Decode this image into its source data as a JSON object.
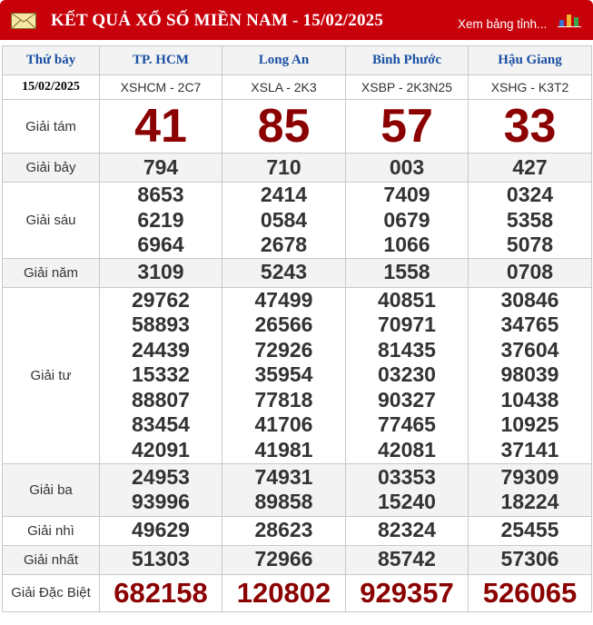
{
  "header": {
    "title": "KẾT QUẢ XỔ SỐ MIỀN NAM - 15/02/2025",
    "more_link": "Xem bảng tỉnh...",
    "bg_color": "#c8000a"
  },
  "table": {
    "day_label": "Thứ bảy",
    "date": "15/02/2025",
    "provinces": [
      {
        "name": "TP. HCM",
        "code": "XSHCM - 2C7"
      },
      {
        "name": "Long An",
        "code": "XSLA - 2K3"
      },
      {
        "name": "Bình Phước",
        "code": "XSBP - 2K3N25"
      },
      {
        "name": "Hậu Giang",
        "code": "XSHG - K3T2"
      }
    ],
    "prizes": {
      "g8": {
        "label": "Giải tám",
        "values": [
          "41",
          "85",
          "57",
          "33"
        ]
      },
      "g7": {
        "label": "Giải bảy",
        "values": [
          "794",
          "710",
          "003",
          "427"
        ]
      },
      "g6": {
        "label": "Giải sáu",
        "values": [
          [
            "8653",
            "6219",
            "6964"
          ],
          [
            "2414",
            "0584",
            "2678"
          ],
          [
            "7409",
            "0679",
            "1066"
          ],
          [
            "0324",
            "5358",
            "5078"
          ]
        ]
      },
      "g5": {
        "label": "Giải năm",
        "values": [
          "3109",
          "5243",
          "1558",
          "0708"
        ]
      },
      "g4": {
        "label": "Giải tư",
        "values": [
          [
            "29762",
            "58893",
            "24439",
            "15332",
            "88807",
            "83454",
            "42091"
          ],
          [
            "47499",
            "26566",
            "72926",
            "35954",
            "77818",
            "41706",
            "41981"
          ],
          [
            "40851",
            "70971",
            "81435",
            "03230",
            "90327",
            "77465",
            "42081"
          ],
          [
            "30846",
            "34765",
            "37604",
            "98039",
            "10438",
            "10925",
            "37141"
          ]
        ]
      },
      "g3": {
        "label": "Giải ba",
        "values": [
          [
            "24953",
            "93996"
          ],
          [
            "74931",
            "89858"
          ],
          [
            "03353",
            "15240"
          ],
          [
            "79309",
            "18224"
          ]
        ]
      },
      "g2": {
        "label": "Giải nhì",
        "values": [
          "49629",
          "28623",
          "82324",
          "25455"
        ]
      },
      "g1": {
        "label": "Giải nhất",
        "values": [
          "51303",
          "72966",
          "85742",
          "57306"
        ]
      },
      "gdb": {
        "label": "Giải Đặc Biệt",
        "values": [
          "682158",
          "120802",
          "929357",
          "526065"
        ]
      }
    }
  },
  "icons": {
    "mail": "envelope-icon",
    "chart": "bar-chart-icon"
  }
}
